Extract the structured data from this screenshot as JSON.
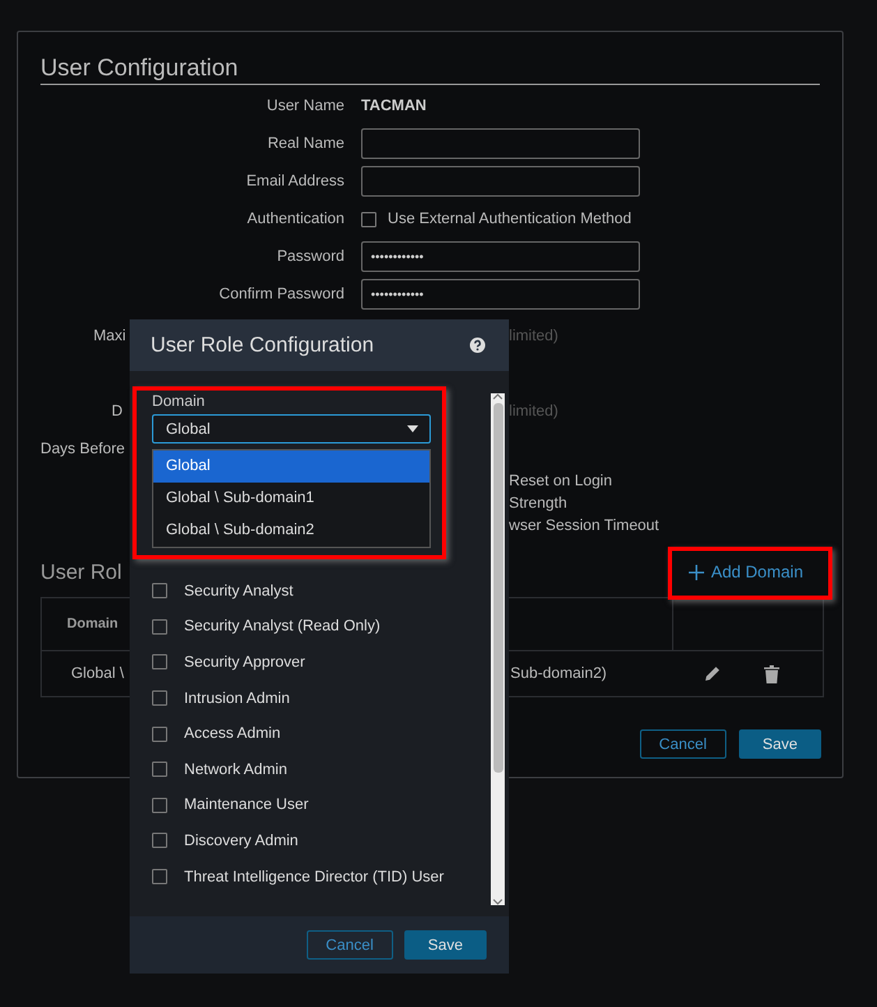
{
  "page_title": "User Configuration",
  "form": [
    {
      "label": "User Name",
      "kind": "value",
      "value": "TACMAN"
    },
    {
      "label": "Real Name",
      "kind": "input"
    },
    {
      "label": "Email Address",
      "kind": "input"
    },
    {
      "label": "Authentication",
      "kind": "checkbox",
      "option": "Use External Authentication Method",
      "checked": false
    },
    {
      "label": "Password",
      "kind": "input",
      "value": "••••••••••••"
    },
    {
      "label": "Confirm Password",
      "kind": "input",
      "value": "••••••••••••"
    }
  ],
  "hidden_rows": [
    {
      "label": "Maxi",
      "note": "limited)"
    },
    {
      "label": "D",
      "note": "limited)"
    },
    {
      "label": "Days Before"
    }
  ],
  "options": [
    "Reset on Login",
    "Strength",
    "wser Session Timeout"
  ],
  "user_roles": {
    "title": "User Rol",
    "add_button": "Add Domain",
    "columns": [
      "Domain"
    ],
    "rows": [
      {
        "cells": [
          "Global \\",
          "Sub-domain2)"
        ]
      }
    ]
  },
  "buttons": [
    {
      "label": "Cancel",
      "kind": "secondary"
    },
    {
      "label": "Save",
      "kind": "primary"
    }
  ],
  "dialog": {
    "title": "User Role Configuration",
    "domain_label": "Domain",
    "domain_value": "Global",
    "domain_options": [
      {
        "label": "Global",
        "selected": true
      },
      {
        "label": "Global \\ Sub-domain1",
        "selected": false
      },
      {
        "label": "Global \\ Sub-domain2",
        "selected": false
      }
    ],
    "roles": [
      {
        "label": "Security Analyst",
        "checked": false
      },
      {
        "label": "Security Analyst (Read Only)",
        "checked": false
      },
      {
        "label": "Security Approver",
        "checked": false
      },
      {
        "label": "Intrusion Admin",
        "checked": false
      },
      {
        "label": "Access Admin",
        "checked": false
      },
      {
        "label": "Network Admin",
        "checked": false
      },
      {
        "label": "Maintenance User",
        "checked": false
      },
      {
        "label": "Discovery Admin",
        "checked": false
      },
      {
        "label": "Threat Intelligence Director (TID) User",
        "checked": false
      }
    ],
    "buttons": [
      {
        "label": "Cancel",
        "kind": "secondary"
      },
      {
        "label": "Save",
        "kind": "primary"
      }
    ]
  }
}
